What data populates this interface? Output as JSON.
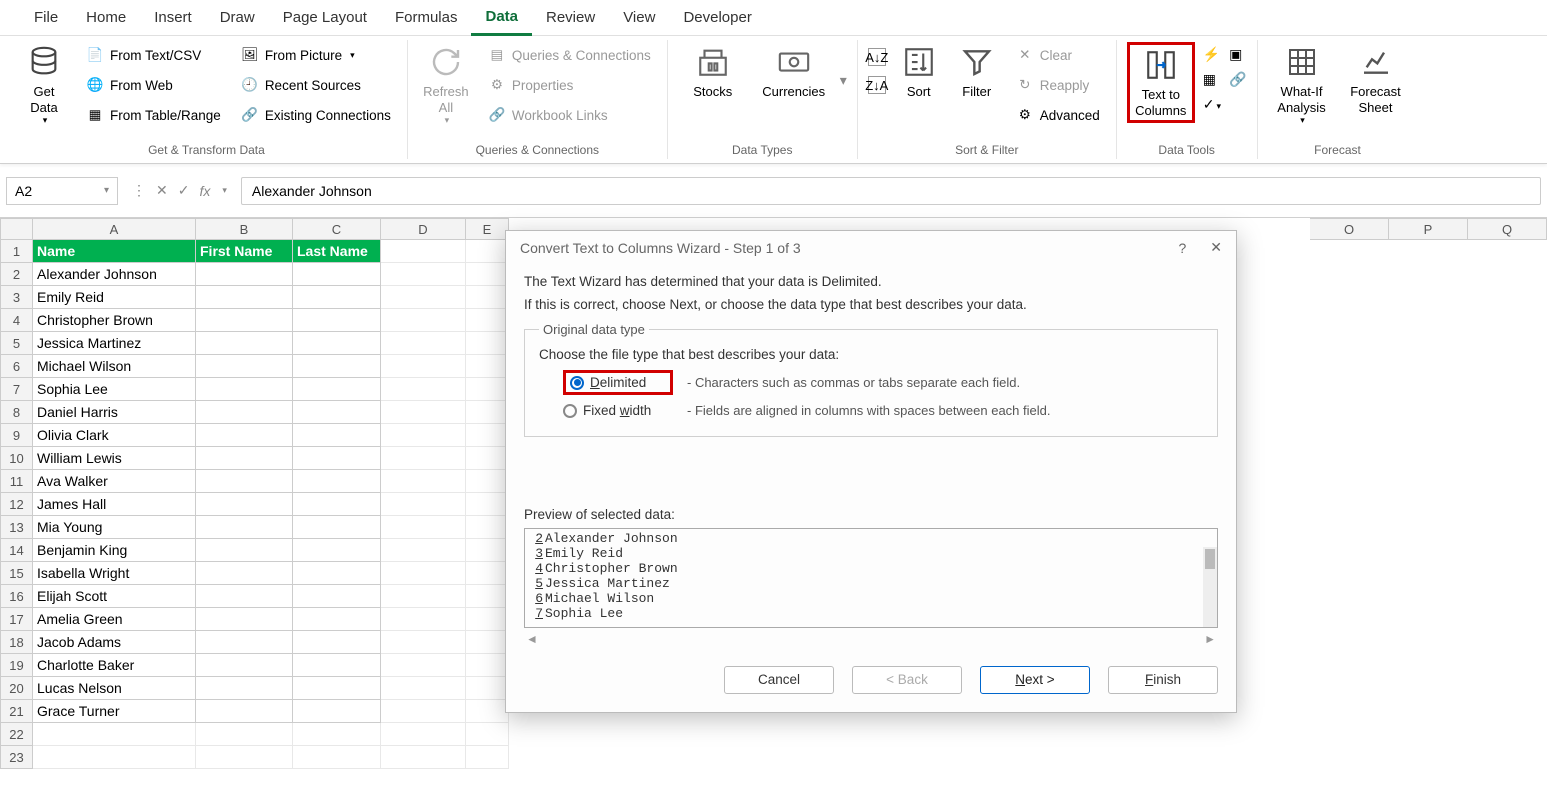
{
  "tabs": [
    "File",
    "Home",
    "Insert",
    "Draw",
    "Page Layout",
    "Formulas",
    "Data",
    "Review",
    "View",
    "Developer"
  ],
  "activeTab": "Data",
  "ribbon": {
    "getTransform": {
      "label": "Get & Transform Data",
      "getData": "Get Data",
      "items": [
        "From Text/CSV",
        "From Web",
        "From Table/Range",
        "From Picture",
        "Recent Sources",
        "Existing Connections"
      ]
    },
    "queries": {
      "label": "Queries & Connections",
      "refresh": "Refresh All",
      "items": [
        "Queries & Connections",
        "Properties",
        "Workbook Links"
      ]
    },
    "dataTypes": {
      "label": "Data Types",
      "stocks": "Stocks",
      "currencies": "Currencies"
    },
    "sortFilter": {
      "label": "Sort & Filter",
      "sort": "Sort",
      "filter": "Filter",
      "clear": "Clear",
      "reapply": "Reapply",
      "advanced": "Advanced"
    },
    "dataTools": {
      "label": "Data Tools",
      "t2c": "Text to Columns"
    },
    "forecast": {
      "label": "Forecast",
      "whatif": "What-If Analysis",
      "sheet": "Forecast Sheet"
    }
  },
  "nameBox": "A2",
  "formulaValue": "Alexander Johnson",
  "columns": [
    "A",
    "B",
    "C",
    "D",
    "E"
  ],
  "extraCols": [
    "O",
    "P",
    "Q"
  ],
  "headers": {
    "A": "Name",
    "B": "First Name",
    "C": "Last Name"
  },
  "rows": [
    "Alexander Johnson",
    "Emily Reid",
    "Christopher Brown",
    "Jessica Martinez",
    "Michael Wilson",
    "Sophia Lee",
    "Daniel Harris",
    "Olivia Clark",
    "William Lewis",
    "Ava Walker",
    "James Hall",
    "Mia Young",
    "Benjamin King",
    "Isabella Wright",
    "Elijah Scott",
    "Amelia Green",
    "Jacob Adams",
    "Charlotte Baker",
    "Lucas Nelson",
    "Grace Turner"
  ],
  "dialog": {
    "title": "Convert Text to Columns Wizard - Step 1 of 3",
    "line1": "The Text Wizard has determined that your data is Delimited.",
    "line2": "If this is correct, choose Next, or choose the data type that best describes your data.",
    "fieldset": "Original data type",
    "choose": "Choose the file type that best describes your data:",
    "opt1": "Delimited",
    "opt1desc": "- Characters such as commas or tabs separate each field.",
    "opt2": "Fixed width",
    "opt2desc": "- Fields are aligned in columns with spaces between each field.",
    "previewLabel": "Preview of selected data:",
    "preview": [
      {
        "n": "2",
        "t": "Alexander Johnson"
      },
      {
        "n": "3",
        "t": "Emily Reid"
      },
      {
        "n": "4",
        "t": "Christopher Brown"
      },
      {
        "n": "5",
        "t": "Jessica Martinez"
      },
      {
        "n": "6",
        "t": "Michael Wilson"
      },
      {
        "n": "7",
        "t": "Sophia Lee"
      }
    ],
    "buttons": {
      "cancel": "Cancel",
      "back": "< Back",
      "next": "Next >",
      "finish": "Finish"
    }
  }
}
